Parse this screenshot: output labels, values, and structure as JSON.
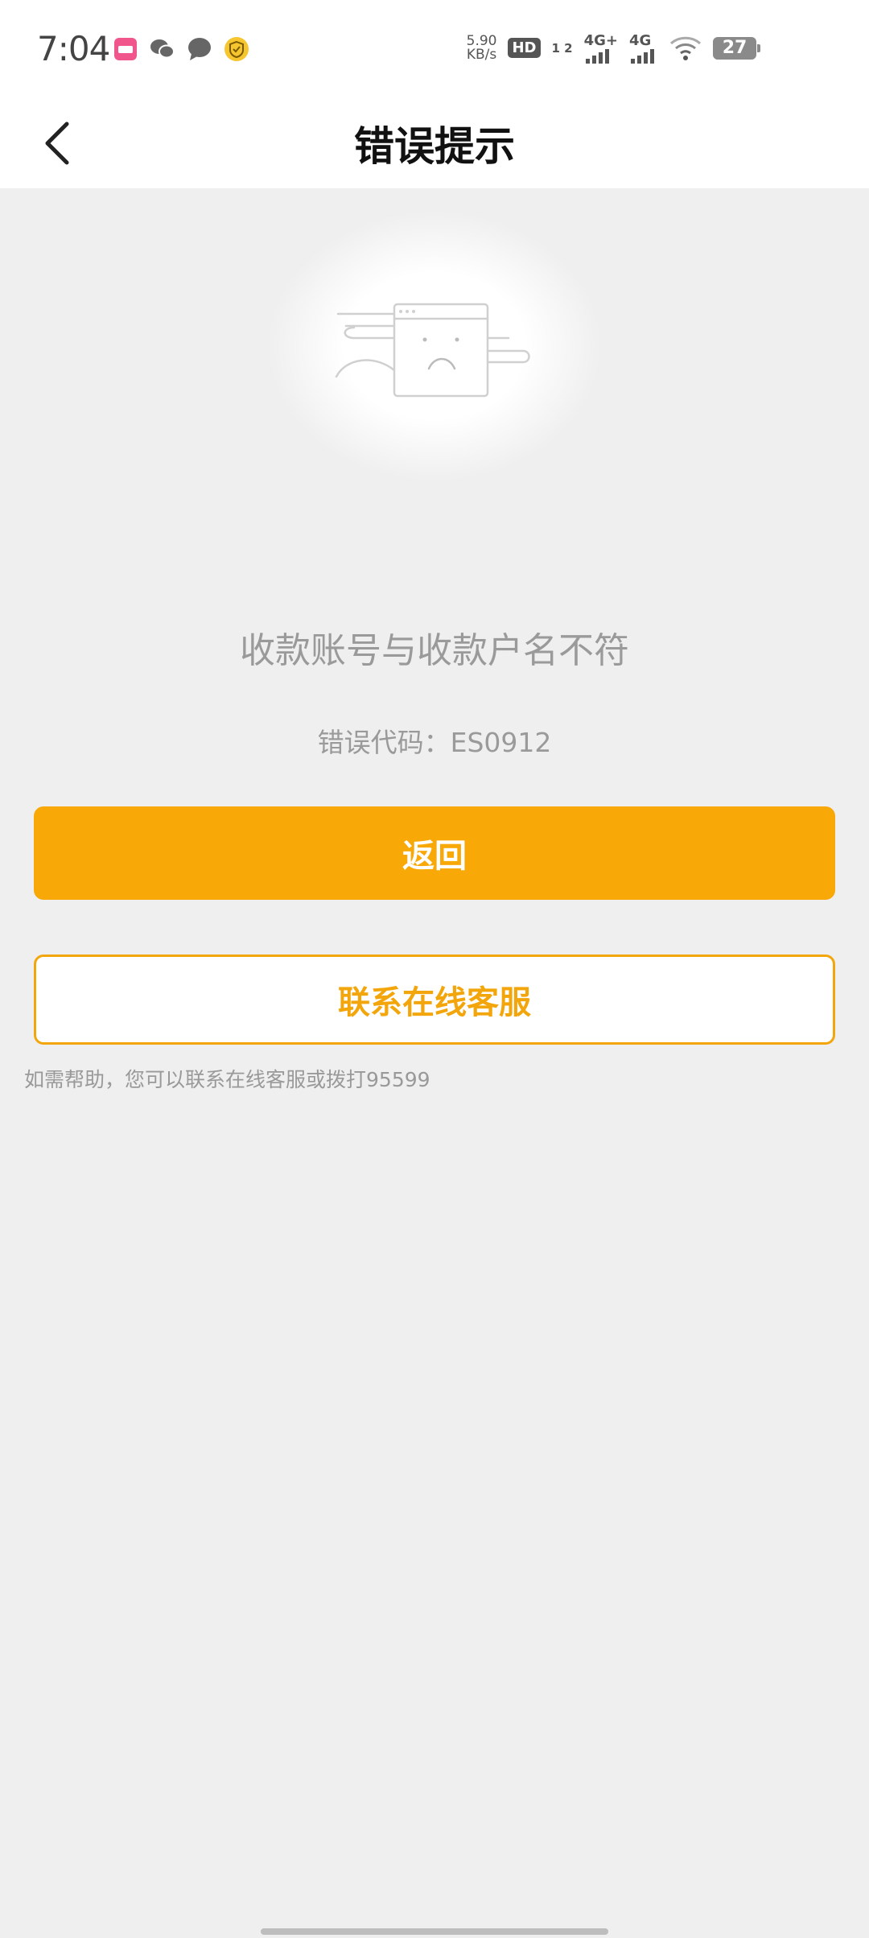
{
  "status_bar": {
    "time": "7:04",
    "net_speed_value": "5.90",
    "net_speed_unit": "KB/s",
    "hd_label": "HD",
    "hd_sim": "1 2",
    "signal1_label": "4G+",
    "signal2_label": "4G",
    "battery": "27",
    "notif_icons": [
      "app-badge-icon",
      "wechat-icon",
      "message-bubble-icon",
      "shield-icon"
    ]
  },
  "nav": {
    "title": "错误提示",
    "back_icon": "chevron-left-icon"
  },
  "content": {
    "illustration_icon": "sad-browser-window-icon",
    "error_message": "收款账号与收款户名不符",
    "error_code": "错误代码：ES0912"
  },
  "buttons": {
    "return_label": "返回",
    "service_label": "联系在线客服"
  },
  "help": {
    "text": "如需帮助，您可以联系在线客服或拨打95599"
  },
  "colors": {
    "accent": "#f8a807",
    "background": "#efefef",
    "muted_text": "#9a9a9a"
  }
}
